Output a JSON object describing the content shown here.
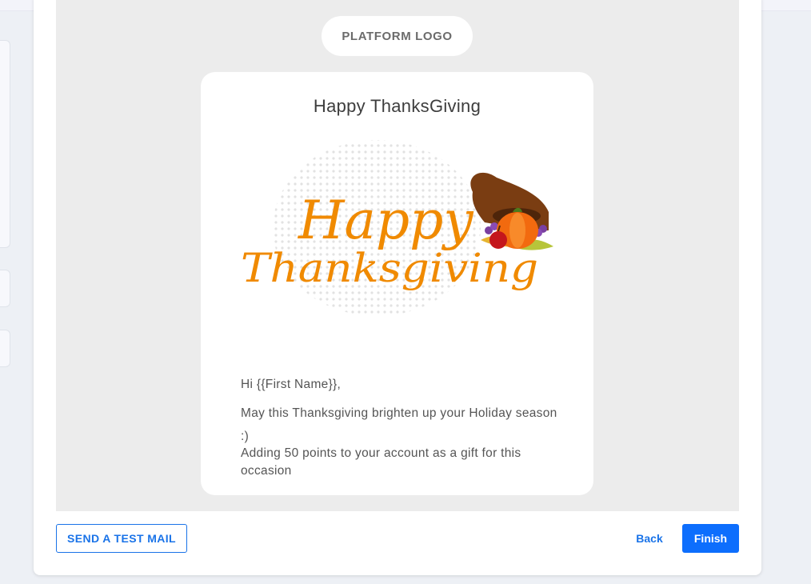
{
  "preview": {
    "logo_label": "PLATFORM LOGO",
    "email": {
      "title": "Happy ThanksGiving",
      "hero_image": {
        "line1": "Happy",
        "line2": "Thanksgiving"
      },
      "greeting": "Hi {{First Name}},",
      "message": "May this Thanksgiving brighten up your Holiday season :)",
      "gift_note": "Adding 50 points to your account as a gift for this occasion"
    }
  },
  "footer": {
    "test_mail_label": "SEND A TEST MAIL",
    "back_label": "Back",
    "finish_label": "Finish"
  },
  "colors": {
    "accent": "#1a73e8",
    "finish_bg": "#0d6efd",
    "hero_text": "#f08a00"
  }
}
